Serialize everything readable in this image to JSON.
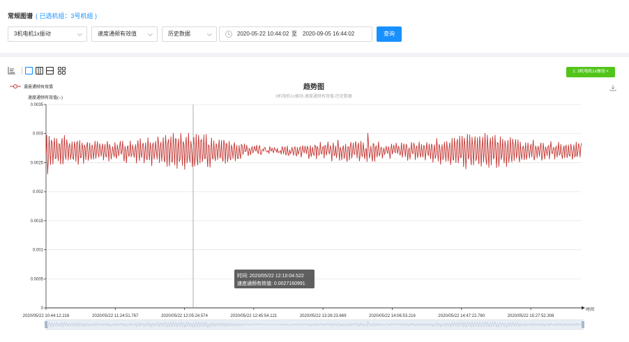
{
  "header": {
    "title": "常规图谱",
    "selected_group": "( 已选机组：3号机组 )"
  },
  "filters": {
    "channel": "3机电机1x振动",
    "metric": "速度通频有效值",
    "data_type": "历史数据",
    "start_time": "2020-05-22 10:44:02",
    "range_sep": "至",
    "end_time": "2020-09-05 16:44:02",
    "query_label": "查询"
  },
  "tag": {
    "label": "1: 3机电机1x振动 ×"
  },
  "colors": {
    "accent": "#1890ff",
    "series": "#c23531",
    "tag": "#52c41a"
  },
  "icons": [
    "line-chart-icon",
    "layout-single-icon",
    "layout-two-column-icon",
    "layout-two-row-icon",
    "layout-grid-icon",
    "download-icon"
  ],
  "chart_data": {
    "type": "line",
    "title": "趋势图",
    "subtitle": "3机电机1x振动-速度通频有效值-历史数据",
    "ylabel": "速度通频有效值(--)",
    "xlabel": "时间",
    "legend": "top-left",
    "legend_label": "速度通频有效值",
    "ylim": [
      0,
      0.0035
    ],
    "y_ticks": [
      "0",
      "0.0005",
      "0.001",
      "0.0015",
      "0.002",
      "0.0025",
      "0.003",
      "0.0035"
    ],
    "y_tick_values": [
      0,
      0.0005,
      0.001,
      0.0015,
      0.002,
      0.0025,
      0.003,
      0.0035
    ],
    "x_ticks": [
      "2020/05/22 10:44:12.216",
      "2020/05/22 11:24:51.767",
      "2020/05/22 12:05:24.574",
      "2020/05/22 12:45:54.121",
      "2020/05/22 13:26:23.669",
      "2020/05/22 14:06:53.216",
      "2020/05/22 14:47:22.760",
      "2020/05/22 15:27:52.308"
    ],
    "series": [
      {
        "name": "速度通频有效值",
        "mean": 0.0027,
        "min_observed": 0.0023,
        "max_observed": 0.00301
      }
    ],
    "tooltip": {
      "time": "时间: 2020/05/22 12:10:04.522",
      "value": "速度通频有效值: 0.0027160991"
    }
  }
}
